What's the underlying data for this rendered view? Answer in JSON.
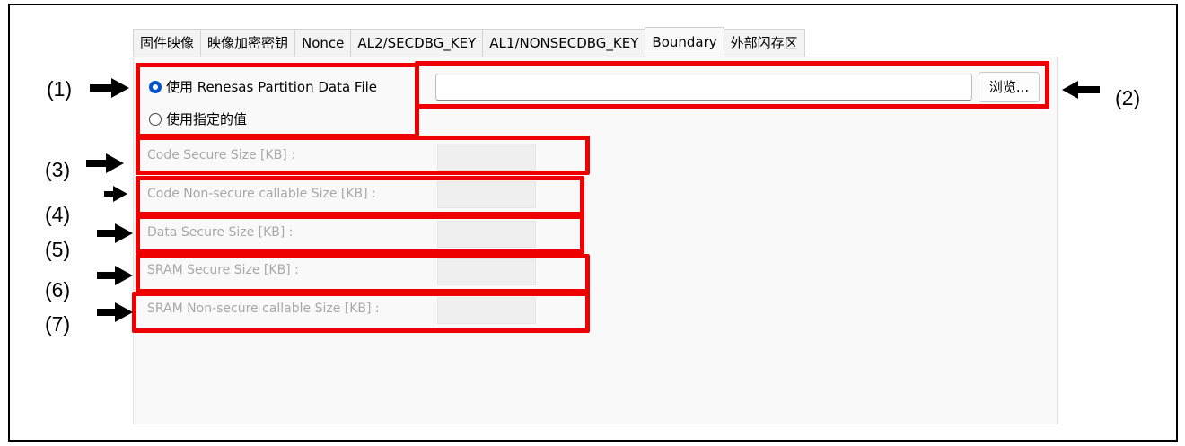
{
  "tabs": [
    {
      "label": "固件映像"
    },
    {
      "label": "映像加密密钥"
    },
    {
      "label": "Nonce"
    },
    {
      "label": "AL2/SECDBG_KEY"
    },
    {
      "label": "AL1/NONSECDBG_KEY"
    },
    {
      "label": "Boundary",
      "active": true
    },
    {
      "label": "外部闪存区"
    }
  ],
  "options": {
    "use_partition_file": "使用 Renesas Partition Data File",
    "use_specified_values": "使用指定的值",
    "selected": "use_partition_file"
  },
  "file_input": {
    "value": ""
  },
  "browse_label": "浏览...",
  "fields": [
    {
      "label": "Code Secure Size [KB] :",
      "value": ""
    },
    {
      "label": "Code Non-secure callable Size [KB] :",
      "value": ""
    },
    {
      "label": "Data Secure Size [KB] :",
      "value": ""
    },
    {
      "label": "SRAM Secure Size [KB] :",
      "value": ""
    },
    {
      "label": "SRAM Non-secure callable Size [KB] :",
      "value": ""
    }
  ],
  "callouts": [
    "(1)",
    "(2)",
    "(3)",
    "(4)",
    "(5)",
    "(6)",
    "(7)"
  ],
  "colors": {
    "highlight": "#ee0000",
    "radio_selected": "#0055cc",
    "disabled_text": "#a8a8a8"
  }
}
